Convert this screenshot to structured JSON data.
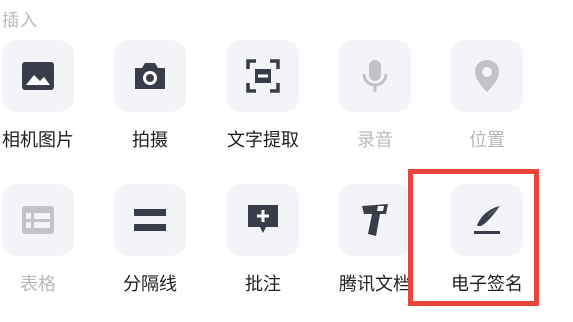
{
  "section": {
    "title": "插入"
  },
  "row1": [
    {
      "label": "相机图片",
      "icon": "image-icon"
    },
    {
      "label": "拍摄",
      "icon": "camera-icon"
    },
    {
      "label": "文字提取",
      "icon": "text-extract-icon"
    },
    {
      "label": "录音",
      "icon": "microphone-icon"
    },
    {
      "label": "位置",
      "icon": "location-pin-icon"
    }
  ],
  "row2": [
    {
      "label": "表格",
      "icon": "table-icon"
    },
    {
      "label": "分隔线",
      "icon": "divider-icon"
    },
    {
      "label": "批注",
      "icon": "comment-add-icon"
    },
    {
      "label": "腾讯文档",
      "icon": "tencent-docs-icon"
    },
    {
      "label": "电子签名",
      "icon": "signature-pen-icon"
    }
  ],
  "colors": {
    "icon_active": "#3a3d49",
    "icon_disabled": "#c2c3c8",
    "tile_bg": "#f3f4f7",
    "highlight": "#e8463c"
  }
}
